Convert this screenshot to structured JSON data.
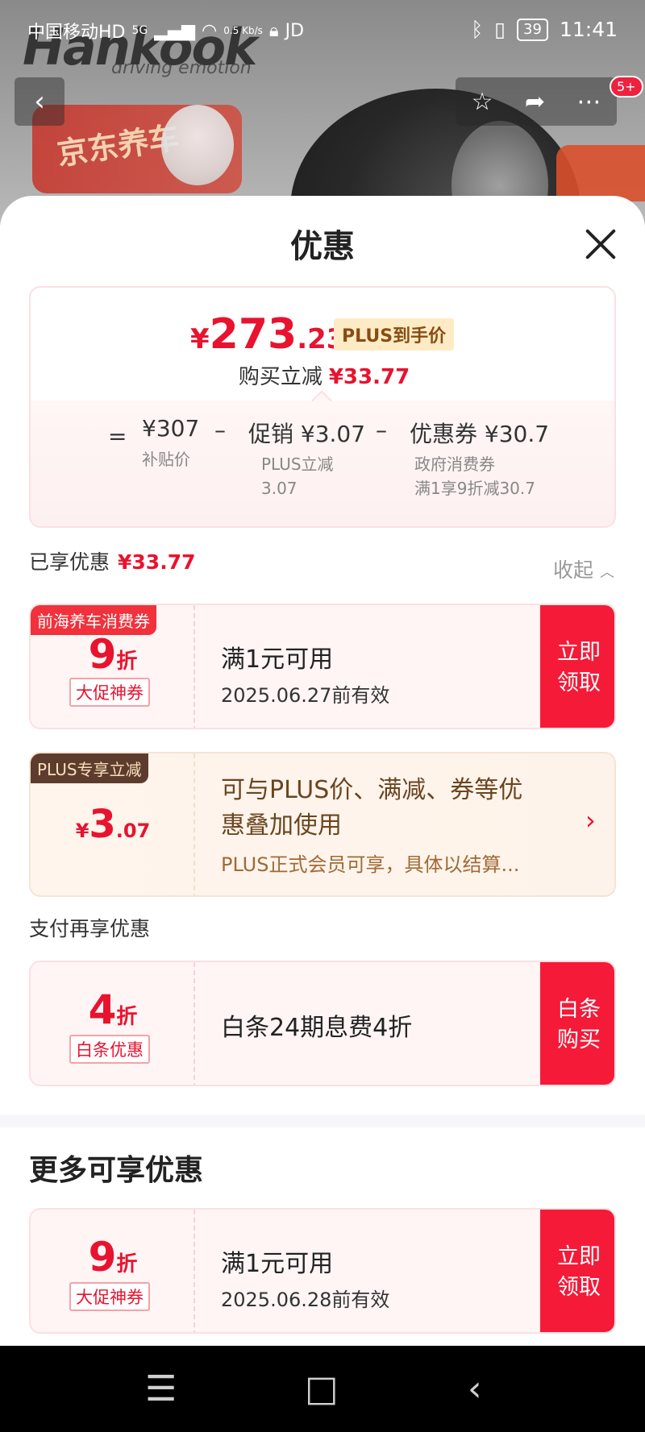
{
  "status_bar": {
    "carrier": "中国移动HD",
    "network": "5G",
    "speed": "0.5 Kb/s",
    "app": "JD",
    "battery": "39",
    "time": "11:41"
  },
  "product_header": {
    "brand": "Hankook",
    "tagline": "driving emotion",
    "promo_badge": "京东养车",
    "notification_count": "5+"
  },
  "sheet": {
    "title": "优惠",
    "price": {
      "yen": "¥",
      "integer": "273",
      "decimal": ".23",
      "plus_tag": "PLUS到手价",
      "instant_label": "购买立减",
      "instant_amount": "¥33.77"
    },
    "formula": {
      "equals": "=",
      "base_value": "¥307",
      "base_label": "补贴价",
      "minus1": "–",
      "promo_value": "促销 ¥3.07",
      "promo_line1": "PLUS立减",
      "promo_line2": "3.07",
      "minus2": "–",
      "coupon_value": "优惠券 ¥30.7",
      "coupon_line1": "政府消费券",
      "coupon_line2": "满1享9折减30.7"
    },
    "enjoyed": {
      "label": "已享优惠",
      "amount": "¥33.77",
      "collapse": "收起"
    },
    "coupons": [
      {
        "ribbon": "前海养车消费券",
        "value": "9",
        "unit": "折",
        "tag": "大促神券",
        "main": "满1元可用",
        "sub": "2025.06.27前有效",
        "action_line1": "立即",
        "action_line2": "领取"
      }
    ],
    "plus": {
      "ribbon": "PLUS专享立减",
      "yen": "¥",
      "integer": "3",
      "decimal": ".07",
      "text": "可与PLUS价、满减、券等优惠叠加使用",
      "note": "PLUS正式会员可享，具体以结算..."
    },
    "payment": {
      "label": "支付再享优惠",
      "value": "4",
      "unit": "折",
      "tag": "白条优惠",
      "main": "白条24期息费4折",
      "action_line1": "白条",
      "action_line2": "购买"
    },
    "more": {
      "title": "更多可享优惠",
      "value": "9",
      "unit": "折",
      "tag": "大促神券",
      "main": "满1元可用",
      "sub": "2025.06.28前有效",
      "action_line1": "立即",
      "action_line2": "领取"
    }
  },
  "system_nav": {
    "menu_icon": "☰",
    "home_icon": "□",
    "back_icon": "‹"
  },
  "colors": {
    "accent_red": "#e8132f",
    "button_red": "#f51a38",
    "plus_brown": "#5e3c2d"
  }
}
